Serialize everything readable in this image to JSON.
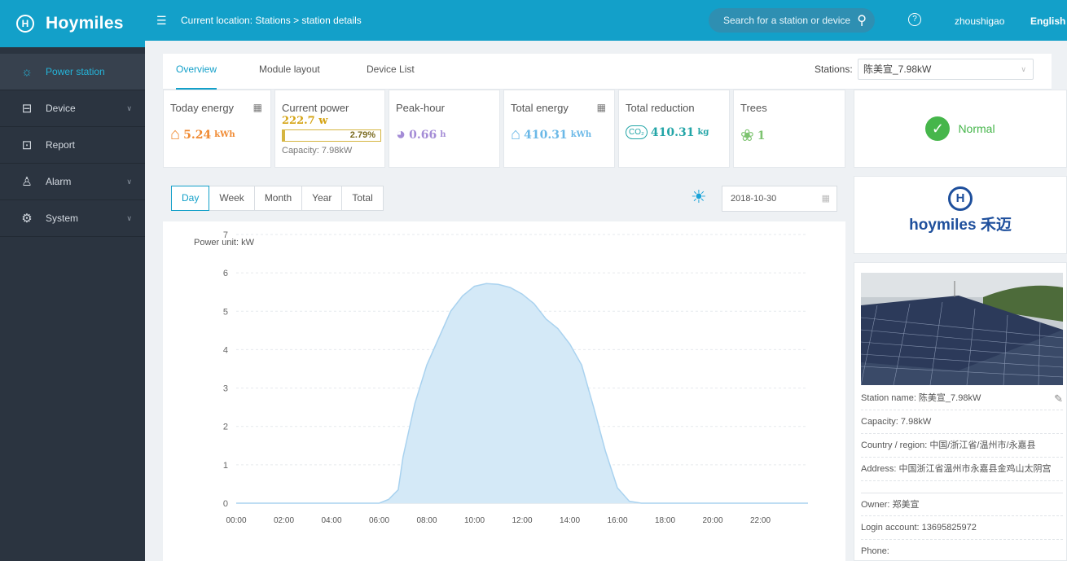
{
  "brand": {
    "name": "Hoymiles",
    "logo_letter": "H"
  },
  "sidebar": {
    "items": [
      {
        "label": "Power station",
        "icon": "sun-icon",
        "glyph": "☼",
        "active": true,
        "has_chevron": false
      },
      {
        "label": "Device",
        "icon": "device-icon",
        "glyph": "⊟",
        "active": false,
        "has_chevron": true
      },
      {
        "label": "Report",
        "icon": "report-icon",
        "glyph": "⊡",
        "active": false,
        "has_chevron": false
      },
      {
        "label": "Alarm",
        "icon": "bell-icon",
        "glyph": "♙",
        "active": false,
        "has_chevron": true
      },
      {
        "label": "System",
        "icon": "gear-icon",
        "glyph": "⚙",
        "active": false,
        "has_chevron": true
      }
    ]
  },
  "topbar": {
    "breadcrumb": "Current location: Stations  >  station details",
    "search_placeholder": "Search for a station or device",
    "username": "zhoushigao",
    "language": "English"
  },
  "tabs": [
    {
      "label": "Overview",
      "active": true
    },
    {
      "label": "Module layout",
      "active": false
    },
    {
      "label": "Device List",
      "active": false
    }
  ],
  "stations": {
    "label": "Stations:",
    "selected": "陈美宣_7.98kW"
  },
  "cards": {
    "today_energy": {
      "title": "Today energy",
      "value": "5.24",
      "unit": "kWh"
    },
    "current_power": {
      "title": "Current power",
      "value": "222.7 w",
      "percent": "2.79%",
      "percent_value": 2.79,
      "capacity": "Capacity: 7.98kW"
    },
    "peak_hour": {
      "title": "Peak-hour",
      "value": "0.66",
      "unit": "h"
    },
    "total_energy": {
      "title": "Total energy",
      "value": "410.31",
      "unit": "kWh"
    },
    "total_reduction": {
      "title": "Total reduction",
      "value": "410.31",
      "unit": "kg",
      "badge": "CO₂"
    },
    "trees": {
      "title": "Trees",
      "value": "1"
    }
  },
  "status": {
    "text": "Normal",
    "color": "#46b64b"
  },
  "chart_controls": {
    "periods": [
      "Day",
      "Week",
      "Month",
      "Year",
      "Total"
    ],
    "active_period": "Day",
    "date": "2018-10-30"
  },
  "chart_data": {
    "type": "area",
    "ylabel": "Power unit: kW",
    "ylim": [
      0,
      7
    ],
    "yticks": [
      "0",
      "1",
      "2",
      "3",
      "4",
      "5",
      "6",
      "7"
    ],
    "xticks": [
      "00:00",
      "02:00",
      "04:00",
      "06:00",
      "08:00",
      "10:00",
      "12:00",
      "14:00",
      "16:00",
      "18:00",
      "20:00",
      "22:00"
    ],
    "x_hours": [
      0,
      6,
      6.4,
      6.8,
      7,
      7.5,
      8,
      8.5,
      9,
      9.5,
      10,
      10.5,
      11,
      11.5,
      12,
      12.5,
      13,
      13.5,
      14,
      14.5,
      15,
      15.5,
      16,
      16.5,
      17,
      17.5,
      18,
      24
    ],
    "y_kw": [
      0,
      0,
      0.1,
      0.35,
      1.2,
      2.6,
      3.6,
      4.3,
      5.0,
      5.4,
      5.65,
      5.72,
      5.7,
      5.62,
      5.45,
      5.2,
      4.8,
      4.55,
      4.15,
      3.6,
      2.5,
      1.35,
      0.4,
      0.05,
      0,
      0,
      0,
      0
    ],
    "fill_color": "#d4e9f7",
    "line_color": "#a9d2ef"
  },
  "logo_card": {
    "letter": "H",
    "word": "hoymiles 禾迈"
  },
  "station_info": {
    "name": "Station name: 陈美宣_7.98kW",
    "capacity": "Capacity: 7.98kW",
    "region": "Country / region: 中国/浙江省/温州市/永嘉县",
    "address": "Address: 中国浙江省温州市永嘉县金鸡山太阴宫",
    "owner": "Owner: 郑美宣",
    "login_account": "Login account: 13695825972",
    "phone": "Phone:"
  }
}
